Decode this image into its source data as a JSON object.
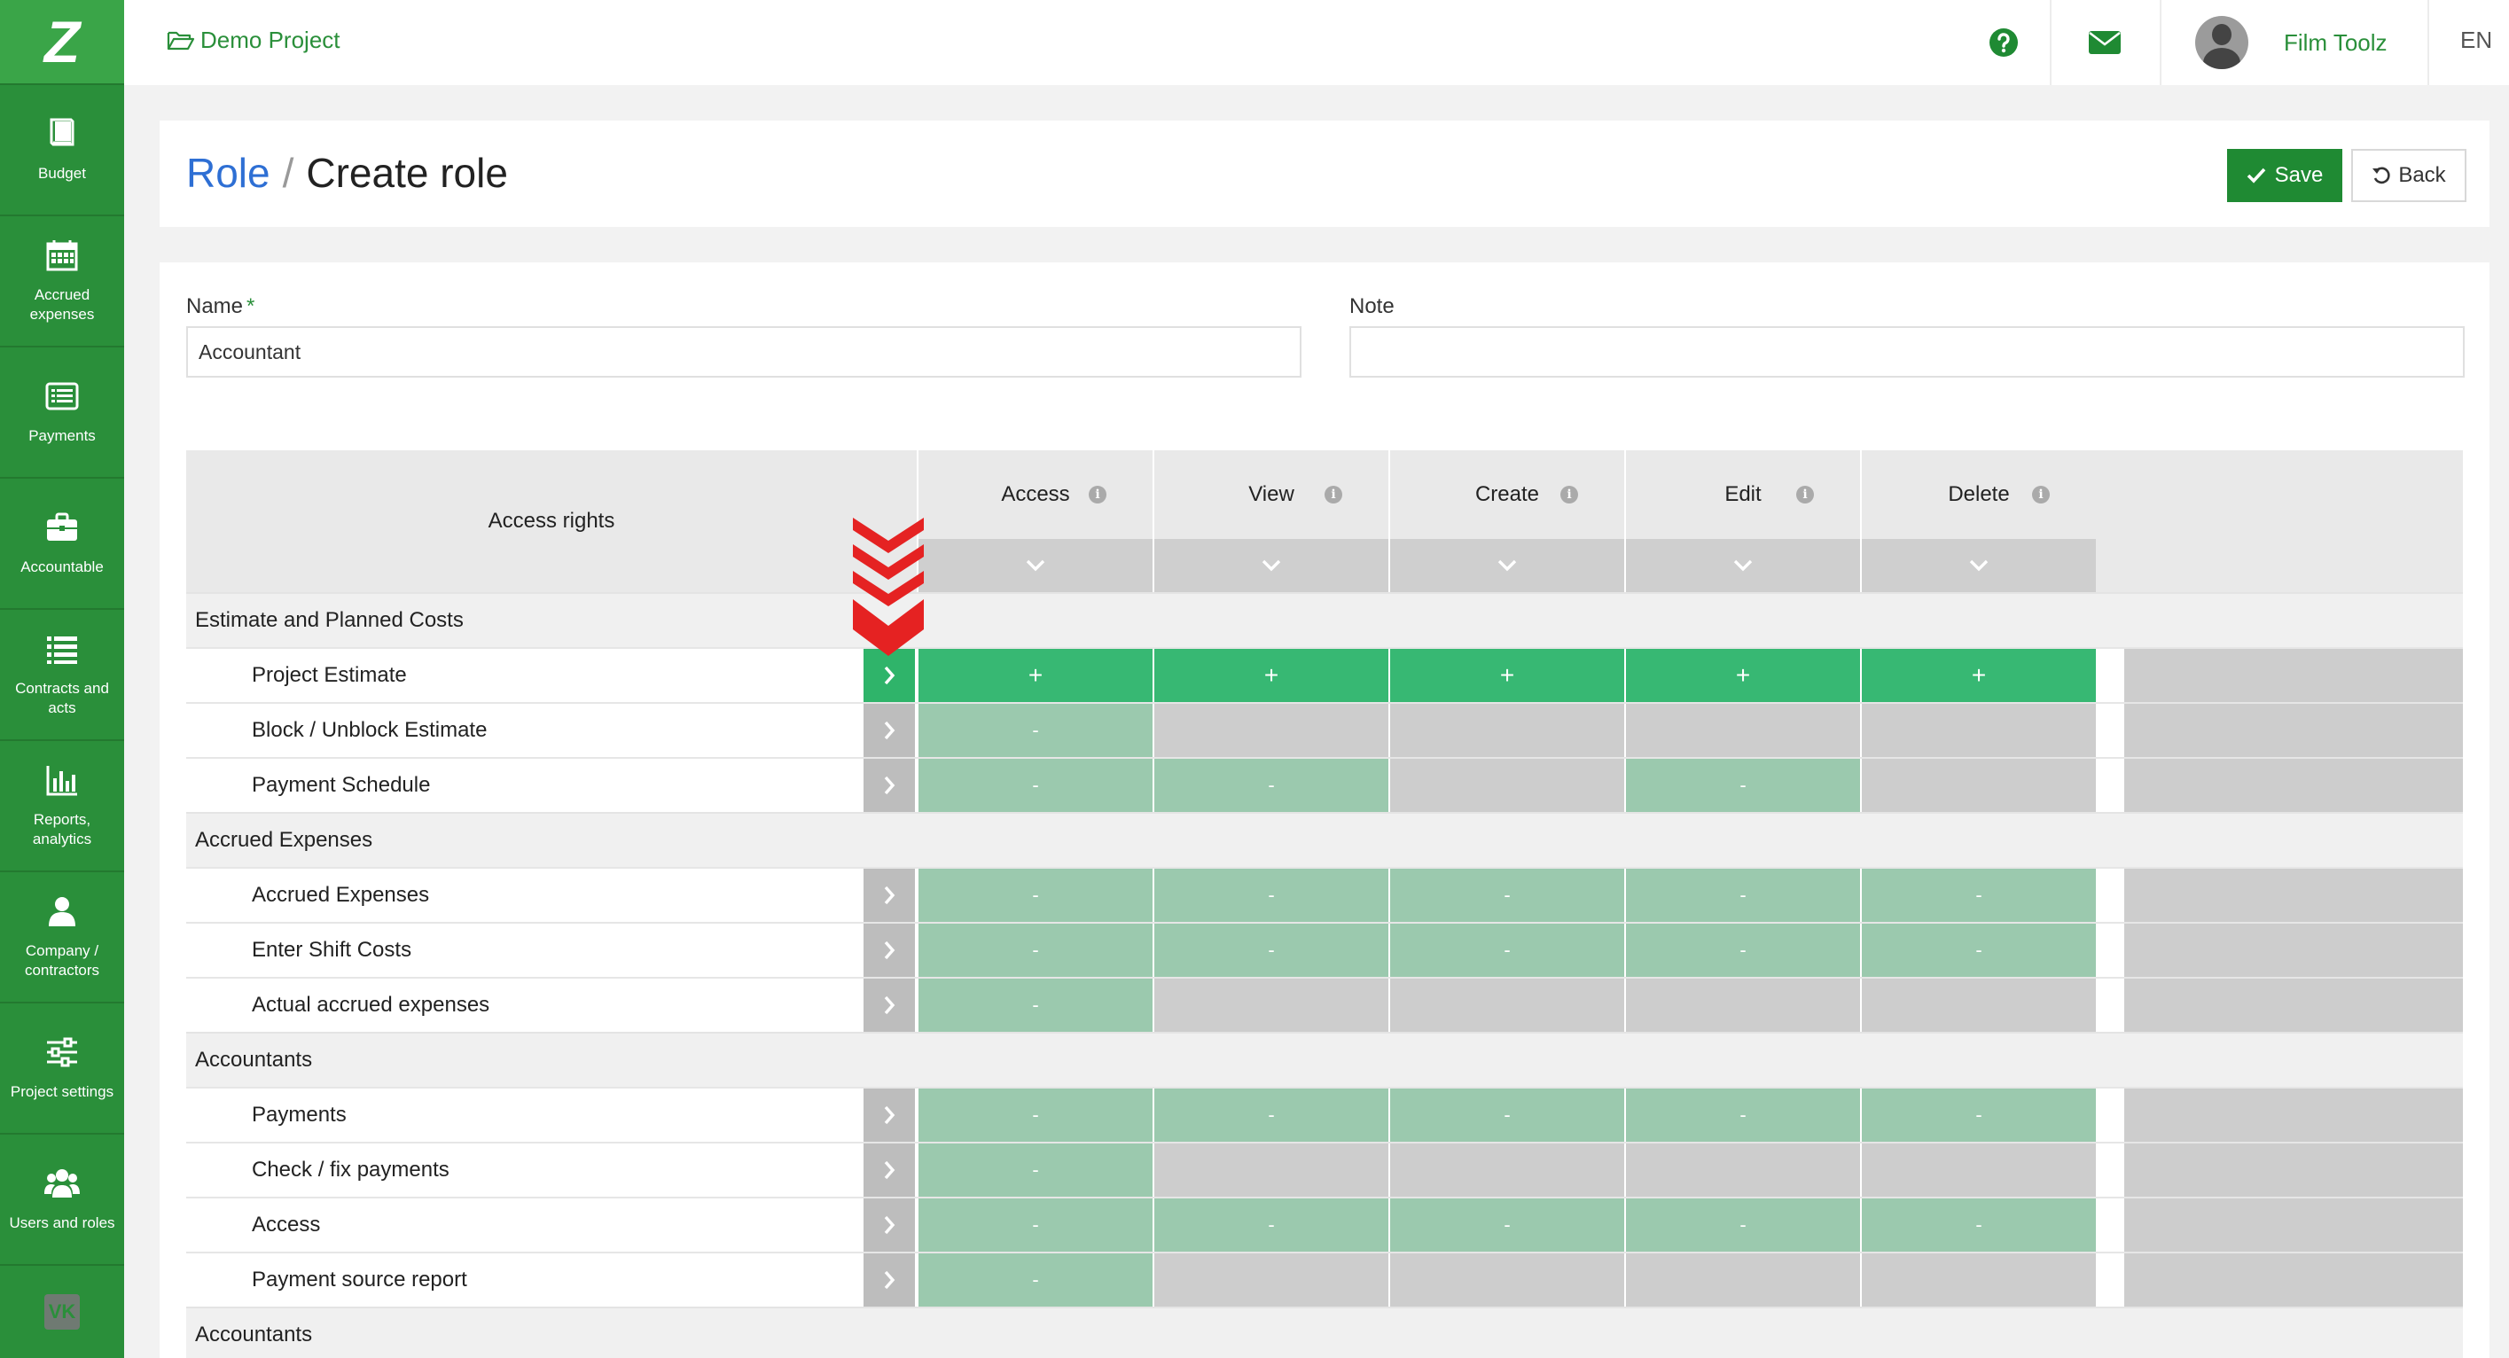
{
  "sidebar": {
    "logo": "Z",
    "items": [
      {
        "label": "Budget",
        "icon": "book-icon"
      },
      {
        "label": "Accrued expenses",
        "icon": "calendar-icon"
      },
      {
        "label": "Payments",
        "icon": "list-alt-icon"
      },
      {
        "label": "Accountable",
        "icon": "briefcase-icon"
      },
      {
        "label": "Contracts and acts",
        "icon": "list-icon"
      },
      {
        "label": "Reports, analytics",
        "icon": "bar-chart-icon"
      },
      {
        "label": "Company / contractors",
        "icon": "user-icon"
      },
      {
        "label": "Project settings",
        "icon": "sliders-icon"
      },
      {
        "label": "Users and roles",
        "icon": "users-icon"
      }
    ],
    "footer_icon": "vk-icon",
    "footer_label": "VK"
  },
  "topbar": {
    "project": "Demo Project",
    "user_name": "Film Toolz",
    "language": "EN"
  },
  "header": {
    "breadcrumb_role": "Role",
    "separator": "/",
    "title": "Create role",
    "save_label": "Save",
    "back_label": "Back"
  },
  "form": {
    "name_label": "Name",
    "required_mark": "*",
    "name_value": "Accountant",
    "note_label": "Note",
    "note_value": ""
  },
  "table": {
    "header_label": "Access rights",
    "columns": [
      "Access",
      "View",
      "Create",
      "Edit",
      "Delete"
    ],
    "info_glyph": "i",
    "sections": [
      {
        "title": "Estimate and Planned Costs",
        "rows": [
          {
            "name": "Project Estimate",
            "active": true,
            "cells": [
              "on",
              "on",
              "on",
              "on",
              "on"
            ],
            "values": [
              "+",
              "+",
              "+",
              "+",
              "+"
            ]
          },
          {
            "name": "Block / Unblock Estimate",
            "active": false,
            "cells": [
              "part",
              "none",
              "none",
              "none",
              "none"
            ],
            "values": [
              "-",
              "",
              "",
              "",
              ""
            ]
          },
          {
            "name": "Payment Schedule",
            "active": false,
            "cells": [
              "part",
              "part",
              "none",
              "part",
              "none"
            ],
            "values": [
              "-",
              "-",
              "",
              "-",
              ""
            ]
          }
        ]
      },
      {
        "title": "Accrued Expenses",
        "rows": [
          {
            "name": "Accrued Expenses",
            "active": false,
            "cells": [
              "part",
              "part",
              "part",
              "part",
              "part"
            ],
            "values": [
              "-",
              "-",
              "-",
              "-",
              "-"
            ]
          },
          {
            "name": "Enter Shift Costs",
            "active": false,
            "cells": [
              "part",
              "part",
              "part",
              "part",
              "part"
            ],
            "values": [
              "-",
              "-",
              "-",
              "-",
              "-"
            ]
          },
          {
            "name": "Actual accrued expenses",
            "active": false,
            "cells": [
              "part",
              "none",
              "none",
              "none",
              "none"
            ],
            "values": [
              "-",
              "",
              "",
              "",
              ""
            ]
          }
        ]
      },
      {
        "title": "Accountants",
        "rows": [
          {
            "name": "Payments",
            "active": false,
            "cells": [
              "part",
              "part",
              "part",
              "part",
              "part"
            ],
            "values": [
              "-",
              "-",
              "-",
              "-",
              "-"
            ]
          },
          {
            "name": "Check / fix payments",
            "active": false,
            "cells": [
              "part",
              "none",
              "none",
              "none",
              "none"
            ],
            "values": [
              "-",
              "",
              "",
              "",
              ""
            ]
          },
          {
            "name": "Access",
            "active": false,
            "cells": [
              "part",
              "part",
              "part",
              "part",
              "part"
            ],
            "values": [
              "-",
              "-",
              "-",
              "-",
              "-"
            ]
          },
          {
            "name": "Payment source report",
            "active": false,
            "cells": [
              "part",
              "none",
              "none",
              "none",
              "none"
            ],
            "values": [
              "-",
              "",
              "",
              "",
              ""
            ]
          }
        ]
      },
      {
        "title": "Accountants",
        "rows": []
      }
    ]
  },
  "colors": {
    "brand_green": "#2a8f3a",
    "cell_on": "#37b873",
    "cell_partial": "#9bc9ae",
    "cell_none": "#cdcdcd",
    "link_blue": "#2e6fd4",
    "marker_red": "#e52222"
  }
}
